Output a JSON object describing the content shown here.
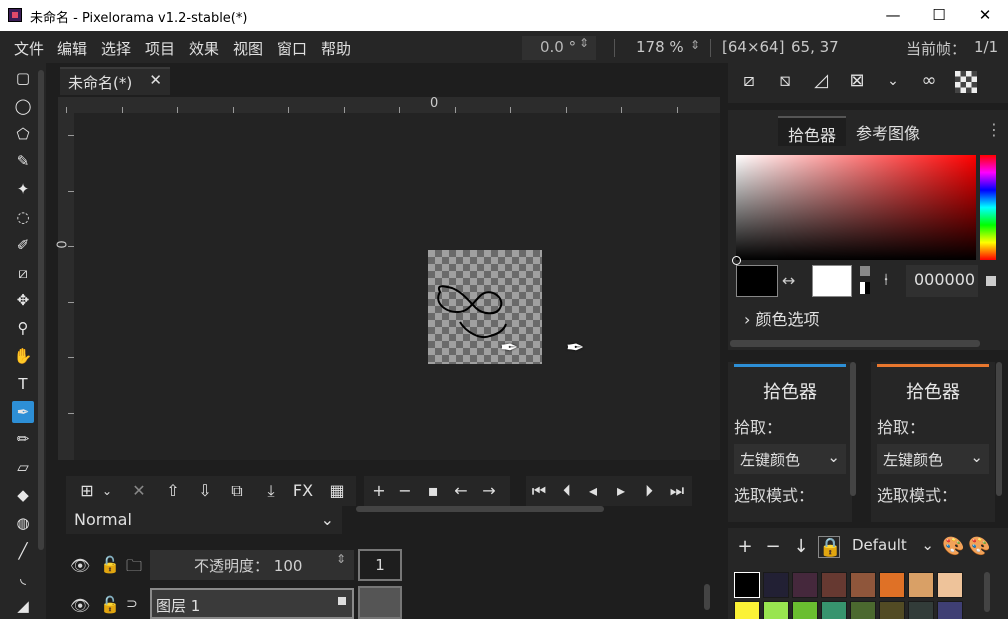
{
  "window": {
    "title": "未命名 - Pixelorama v1.2-stable(*)",
    "minimize": "—",
    "maximize": "☐",
    "close": "✕"
  },
  "menubar": {
    "items": [
      "文件",
      "编辑",
      "选择",
      "项目",
      "效果",
      "视图",
      "窗口",
      "帮助"
    ],
    "rotation": "0.0 °",
    "zoom": "178 %",
    "canvas_size": "[64×64]",
    "cursor_pos": "65, 37",
    "current_frame_label": "当前帧：",
    "current_frame_value": "1/1"
  },
  "toolbar": {
    "tools": [
      {
        "name": "rect-select-icon",
        "glyph": "▢"
      },
      {
        "name": "ellipse-select-icon",
        "glyph": "◯"
      },
      {
        "name": "polygon-select-icon",
        "glyph": "⬠"
      },
      {
        "name": "color-select-icon",
        "glyph": "✎"
      },
      {
        "name": "magic-wand-icon",
        "glyph": "✦"
      },
      {
        "name": "lasso-icon",
        "glyph": "◌"
      },
      {
        "name": "paint-select-icon",
        "glyph": "✐"
      },
      {
        "name": "crop-icon",
        "glyph": "⧄"
      },
      {
        "name": "move-icon",
        "glyph": "✥"
      },
      {
        "name": "zoom-icon",
        "glyph": "⚲"
      },
      {
        "name": "pan-icon",
        "glyph": "✋"
      },
      {
        "name": "text-icon",
        "glyph": "T"
      },
      {
        "name": "color-picker-icon",
        "glyph": "✒"
      },
      {
        "name": "pencil-icon",
        "glyph": "✏"
      },
      {
        "name": "eraser-icon",
        "glyph": "▱"
      },
      {
        "name": "bucket-icon",
        "glyph": "◆"
      },
      {
        "name": "shading-icon",
        "glyph": "◍"
      },
      {
        "name": "line-icon",
        "glyph": "╱"
      },
      {
        "name": "curve-icon",
        "glyph": "◟"
      },
      {
        "name": "shape-icon",
        "glyph": "◢"
      }
    ],
    "active_index": 12
  },
  "canvas": {
    "tab_label": "未命名(*)",
    "tab_close": "✕",
    "ruler_top_origin": "0",
    "ruler_left_origin": "0"
  },
  "timeline": {
    "blend_mode": "Normal",
    "opacity_label": "不透明度：",
    "opacity_value": "100",
    "frame_number": "1",
    "layer_name": "图层 1",
    "fx_label": "FX"
  },
  "right_panel": {
    "tabs": [
      "拾色器",
      "参考图像"
    ],
    "active_tab": 0,
    "hex_value": "000000",
    "color_options_label": "颜色选项",
    "left_color": "#000000",
    "right_color": "#ffffff",
    "left_tool": {
      "title": "拾色器",
      "pick_label": "拾取：",
      "pick_value": "左键颜色",
      "mode_label": "选取模式：",
      "accent": "#2d8fd6"
    },
    "right_tool": {
      "title": "拾色器",
      "pick_label": "拾取：",
      "pick_value": "左键颜色",
      "mode_label": "选取模式：",
      "accent": "#e8772e"
    },
    "palette_name": "Default",
    "palette_row1": [
      "#000000",
      "#222034",
      "#45283c",
      "#663931",
      "#8f563b",
      "#df7126",
      "#d9a066",
      "#eec39a"
    ],
    "palette_row2": [
      "#fbf236",
      "#99e550",
      "#6abe30",
      "#37946e",
      "#4b692f",
      "#524b24",
      "#323c39",
      "#3f3f74"
    ]
  }
}
